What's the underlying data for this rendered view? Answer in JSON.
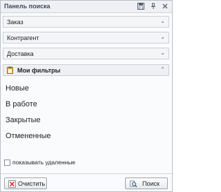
{
  "panel": {
    "title": "Панель поиска",
    "icons": [
      "save-icon",
      "pin-icon",
      "close-icon"
    ]
  },
  "sections": [
    {
      "label": "Заказ",
      "icon": "chevron-down-icon"
    },
    {
      "label": "Контрагент",
      "icon": "chevron-down-icon"
    },
    {
      "label": "Доставка",
      "icon": "chevron-down-icon"
    }
  ],
  "my_filters": {
    "label": "Мои фильтры",
    "icon": "clipboard-icon",
    "toggle_icon": "chevron-up-icon",
    "items": [
      "Новые",
      "В работе",
      "Закрытые",
      "Отмененные"
    ]
  },
  "show_deleted": {
    "label": "показывать удаленные",
    "checked": false
  },
  "buttons": {
    "clear_label": "Очистить",
    "clear_icon": "clear-icon",
    "search_label": "Поиск",
    "search_icon": "search-icon"
  },
  "colors": {
    "title_text": "#3b4b5e",
    "clear_icon": "#d9342b"
  }
}
